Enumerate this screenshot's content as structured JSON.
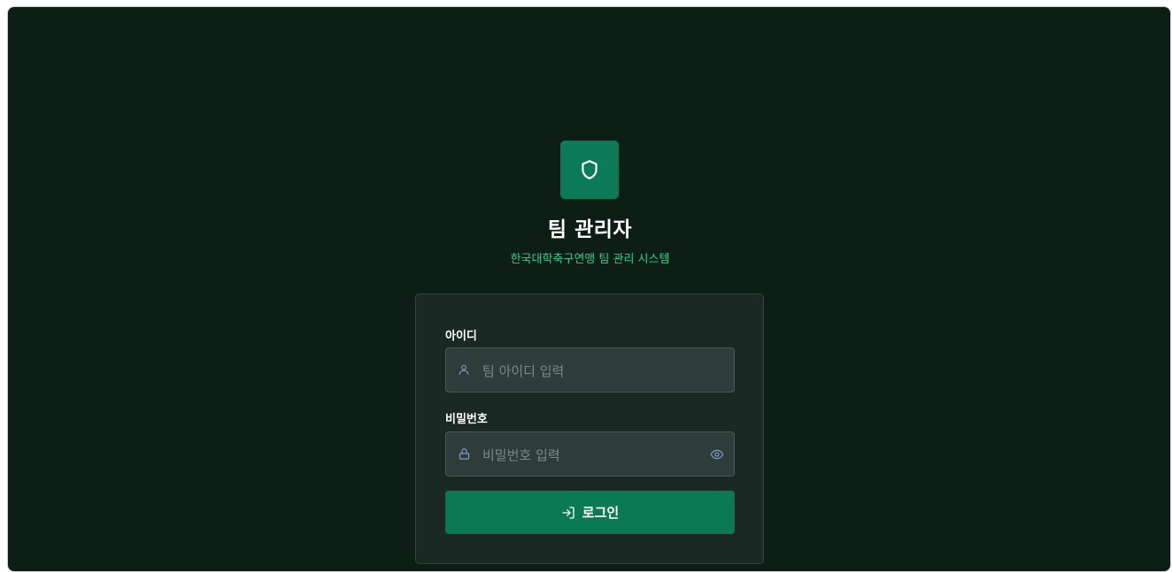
{
  "app": {
    "title": "팀 관리자",
    "subtitle": "한국대학축구연맹 팀 관리 시스템",
    "logo_icon": "shield-icon"
  },
  "form": {
    "username": {
      "label": "아이디",
      "placeholder": "팀 아이디 입력",
      "value": "",
      "icon": "user-icon"
    },
    "password": {
      "label": "비밀번호",
      "placeholder": "비밀번호 입력",
      "value": "",
      "icon": "lock-icon",
      "toggle_icon": "eye-icon"
    },
    "submit": {
      "label": "로그인",
      "icon": "login-arrow-icon"
    }
  },
  "colors": {
    "background": "#0c1e15",
    "accent": "#0b7a56",
    "subtitle": "#2fcf8c",
    "card": "#1b2925",
    "input": "#2e3d39"
  }
}
